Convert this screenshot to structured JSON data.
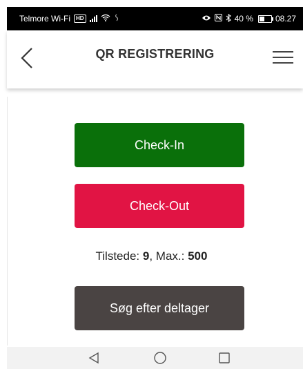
{
  "status_bar": {
    "carrier": "Telmore Wi-Fi",
    "carrier_badge": "HD",
    "battery_percent": "40 %",
    "time": "08.27",
    "icons": [
      "signal-icon",
      "wifi-icon",
      "eye-icon",
      "nfc-icon",
      "bluetooth-icon",
      "battery-icon"
    ]
  },
  "app_bar": {
    "title": "QR REGISTRERING",
    "back_icon": "chevron-left-icon",
    "menu_icon": "hamburger-menu-icon"
  },
  "actions": {
    "checkin_label": "Check-In",
    "checkout_label": "Check-Out",
    "search_label": "Søg efter deltager"
  },
  "stats": {
    "present_label": "Tilstede: ",
    "present_value": "9",
    "separator": ", Max.: ",
    "max_value": "500"
  },
  "colors": {
    "checkin": "#0a700a",
    "checkout": "#e11444",
    "search": "#4a4443"
  },
  "nav_bar": {
    "icons": [
      "nav-back-icon",
      "nav-home-icon",
      "nav-recents-icon"
    ]
  }
}
